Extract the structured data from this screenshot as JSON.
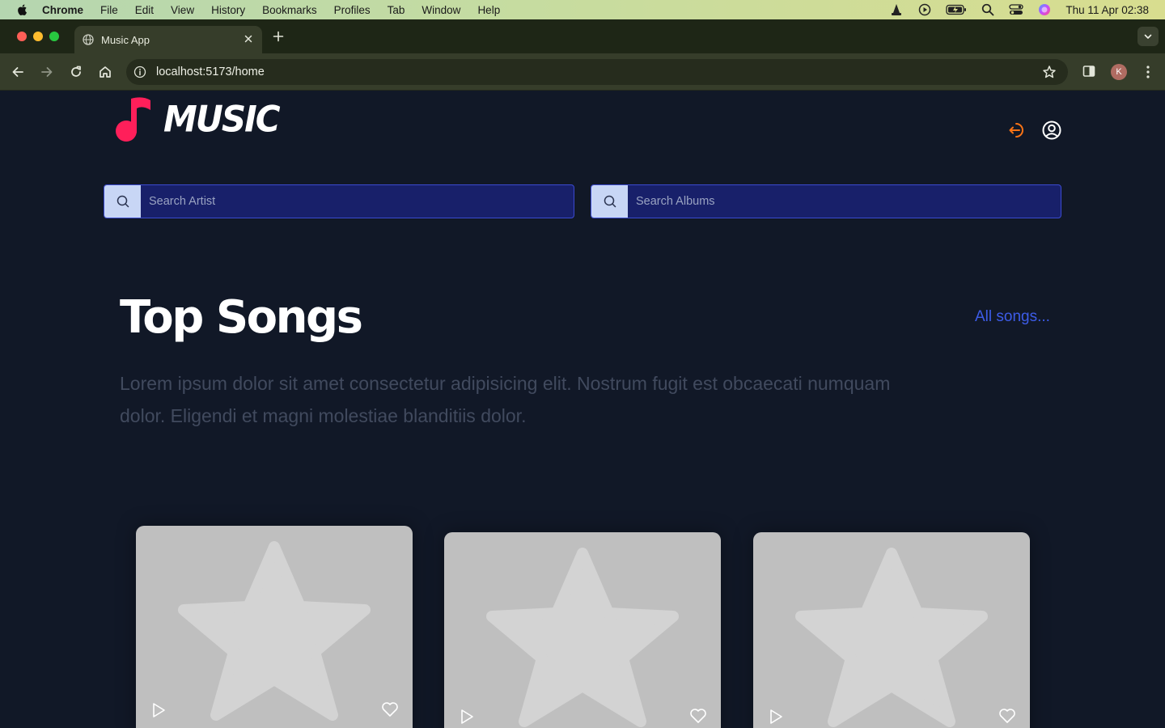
{
  "menubar": {
    "app_name": "Chrome",
    "items": [
      "File",
      "Edit",
      "View",
      "History",
      "Bookmarks",
      "Profiles",
      "Tab",
      "Window",
      "Help"
    ],
    "clock": "Thu 11 Apr  02:38"
  },
  "browser": {
    "tab_title": "Music App",
    "url": "localhost:5173/home",
    "profile_initial": "K"
  },
  "app": {
    "logo_text": "MUSIC",
    "brand_color": "#ff1f5a",
    "search_artist_placeholder": "Search Artist",
    "search_albums_placeholder": "Search Albums"
  },
  "top_songs": {
    "title": "Top Songs",
    "all_link": "All songs...",
    "description": "Lorem ipsum dolor sit amet consectetur adipisicing elit. Nostrum fugit est obcaecati numquam dolor. Eligendi et magni molestiae blanditiis dolor.",
    "cards": [
      {
        "thumbnail": "star-placeholder",
        "play": "play-icon",
        "like": "heart-icon"
      },
      {
        "thumbnail": "star-placeholder",
        "play": "play-icon",
        "like": "heart-icon"
      },
      {
        "thumbnail": "star-placeholder",
        "play": "play-icon",
        "like": "heart-icon"
      }
    ]
  }
}
